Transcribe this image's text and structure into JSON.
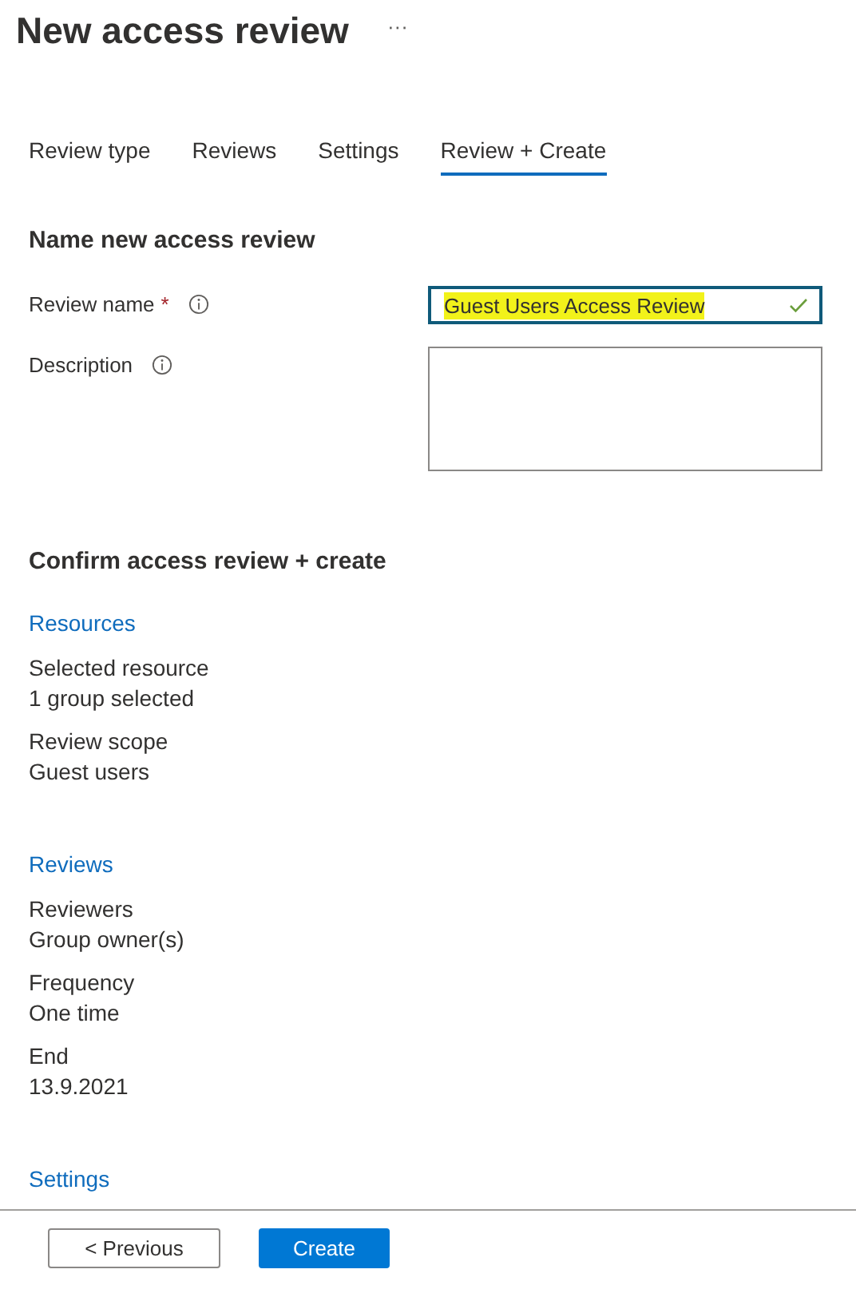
{
  "header": {
    "title": "New access review",
    "more": "···"
  },
  "tabs": [
    {
      "label": "Review type",
      "selected": false
    },
    {
      "label": "Reviews",
      "selected": false
    },
    {
      "label": "Settings",
      "selected": false
    },
    {
      "label": "Review + Create",
      "selected": true
    }
  ],
  "form": {
    "heading": "Name new access review",
    "fields": [
      {
        "kind": "input",
        "label": "Review name",
        "required_mark": "*",
        "value": "Guest Users Access Review",
        "valid": true,
        "highlighted": true
      },
      {
        "kind": "textarea",
        "label": "Description"
      }
    ]
  },
  "summary": {
    "heading": "Confirm access review + create",
    "sections": [
      {
        "title": "Resources",
        "items": [
          {
            "label": "Selected resource",
            "value": "1 group selected"
          },
          {
            "label": "Review scope",
            "value": "Guest users"
          }
        ]
      },
      {
        "title": "Reviews",
        "items": [
          {
            "label": "Reviewers",
            "value": "Group owner(s)"
          },
          {
            "label": "Frequency",
            "value": "One time"
          },
          {
            "label": "End",
            "value": "13.9.2021"
          }
        ]
      },
      {
        "title": "Settings"
      }
    ]
  },
  "footer": {
    "buttons": [
      {
        "kind": "secondary",
        "label": "< Previous"
      },
      {
        "kind": "primary",
        "label": "Create"
      }
    ]
  }
}
